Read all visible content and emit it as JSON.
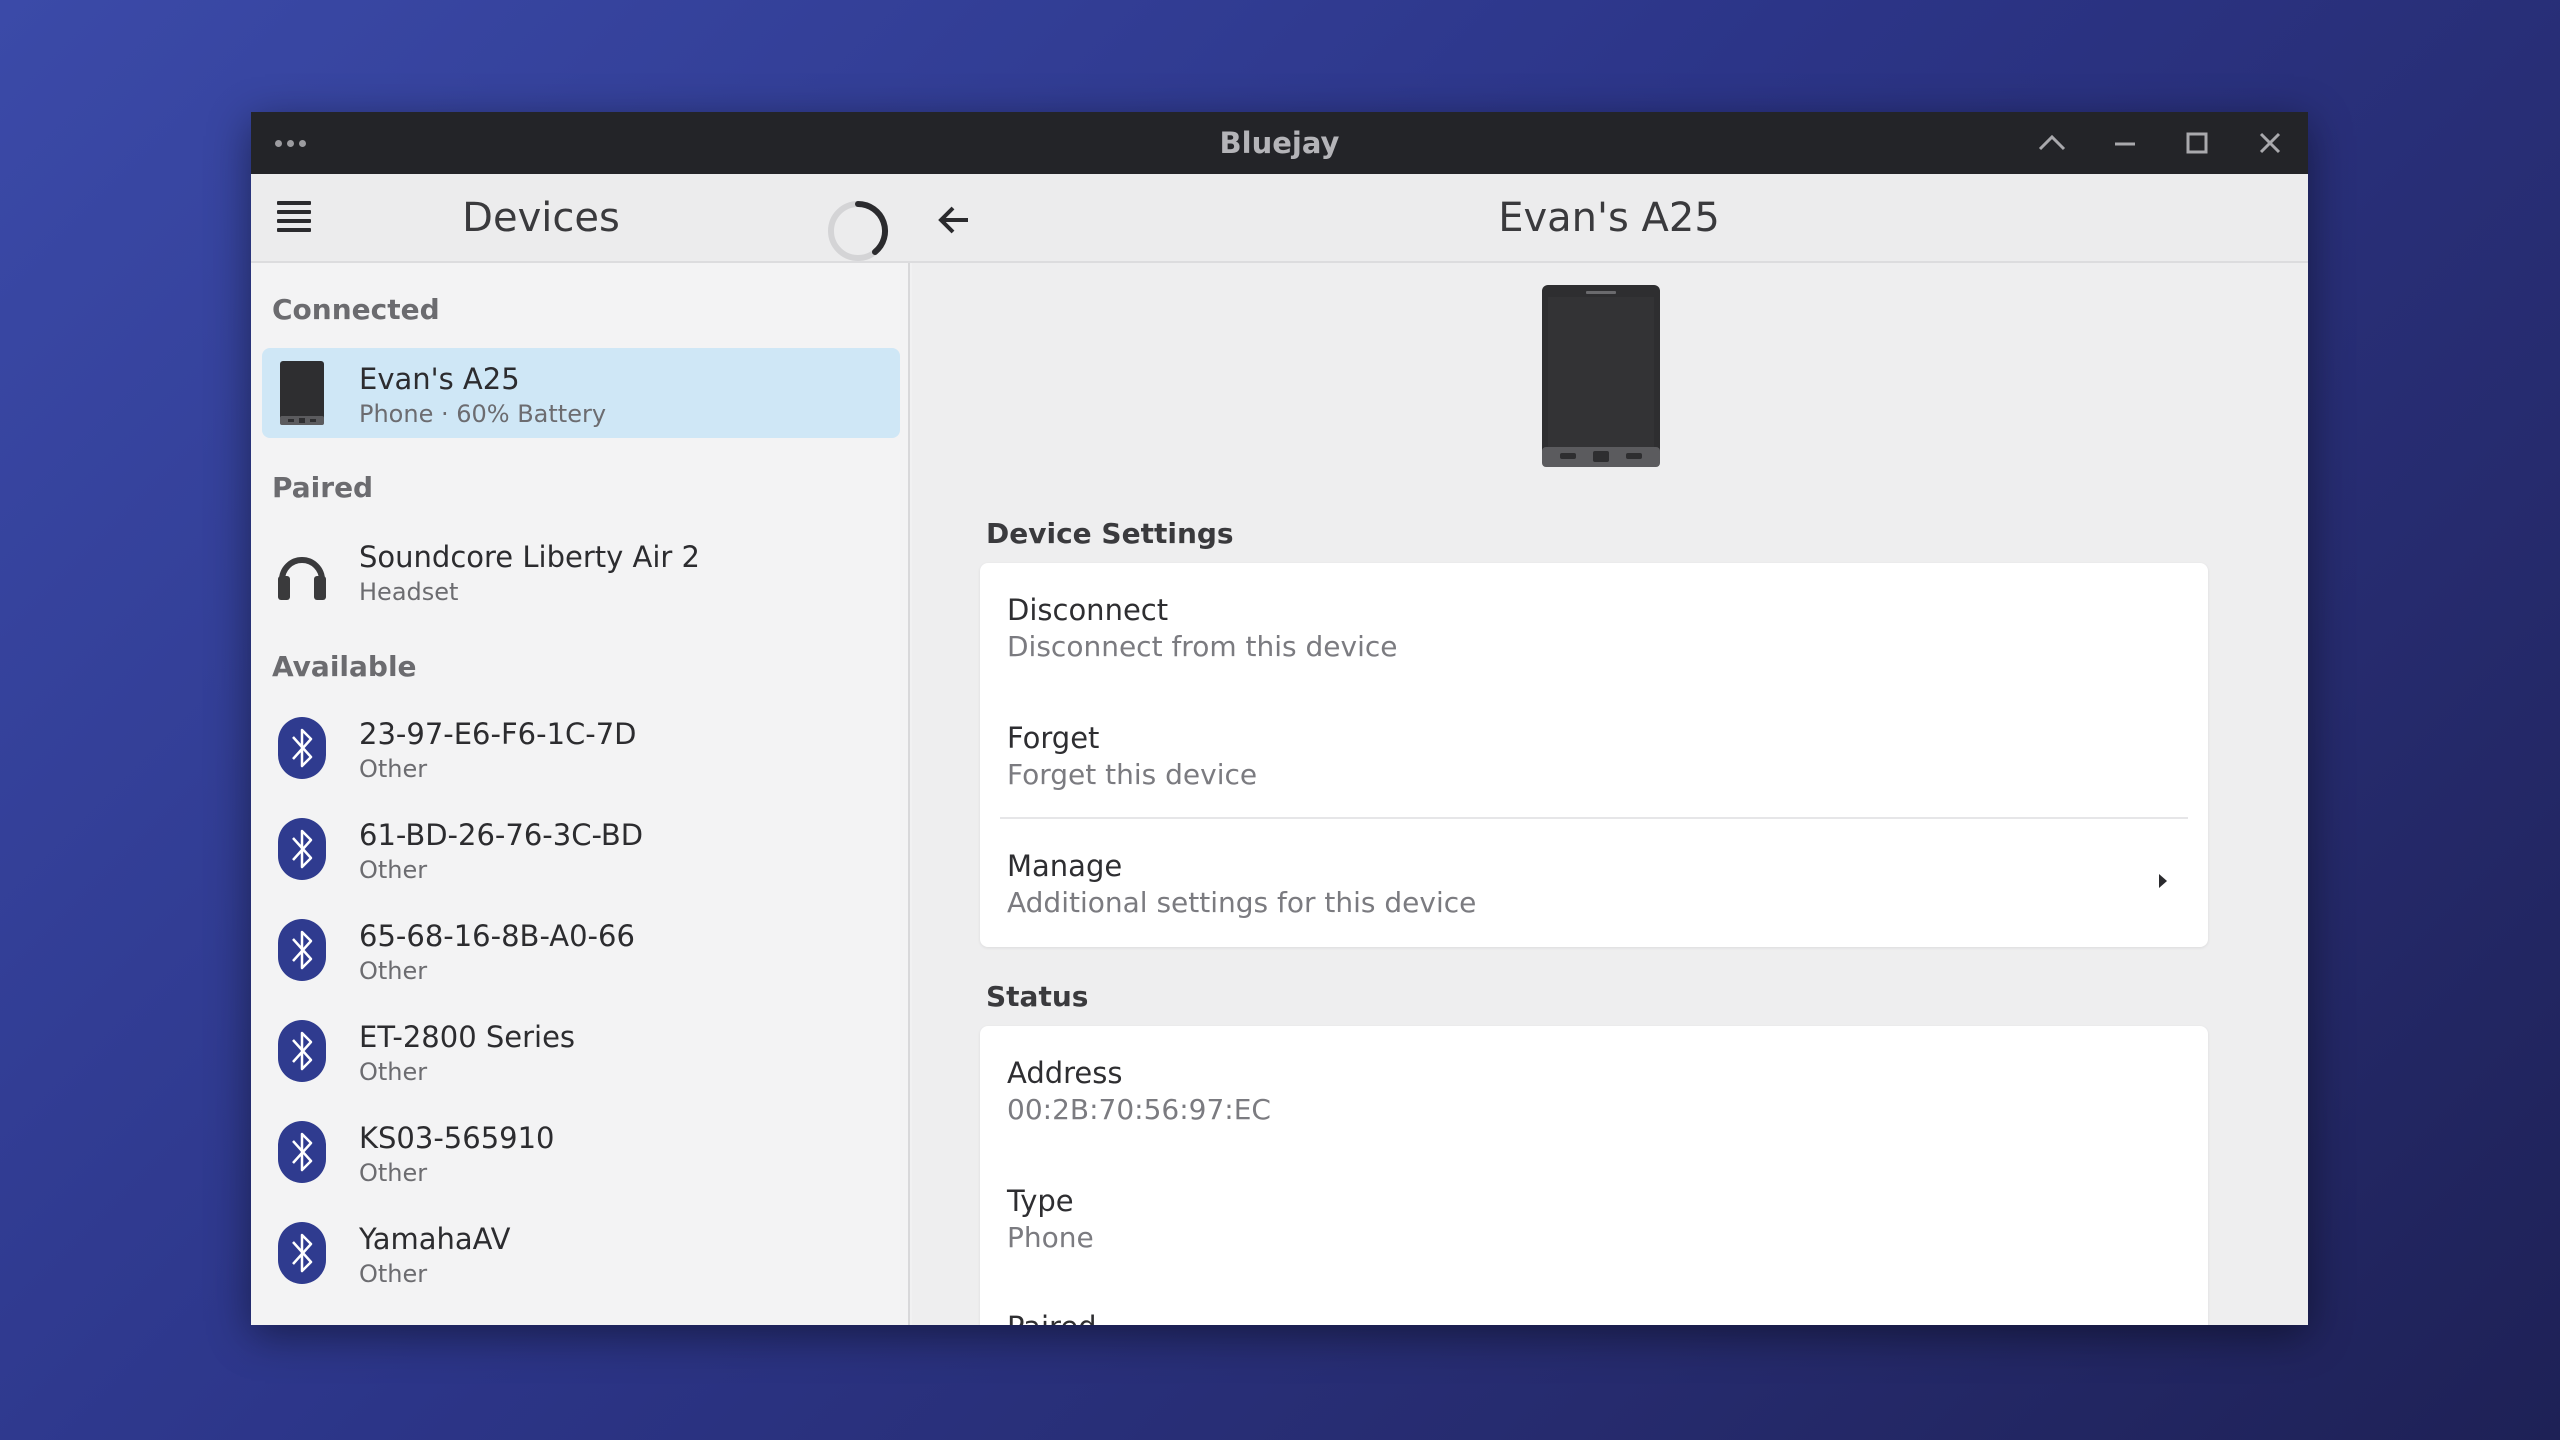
{
  "window": {
    "title": "Bluejay"
  },
  "left_header": {
    "title": "Devices"
  },
  "right_header": {
    "title": "Evan's A25"
  },
  "sections": {
    "connected": "Connected",
    "paired": "Paired",
    "available": "Available"
  },
  "connected_devices": [
    {
      "name": "Evan's A25",
      "sub": "Phone · 60% Battery",
      "icon": "phone-icon"
    }
  ],
  "paired_devices": [
    {
      "name": "Soundcore Liberty Air 2",
      "sub": "Headset",
      "icon": "headset-icon"
    }
  ],
  "available_devices": [
    {
      "name": "23-97-E6-F6-1C-7D",
      "sub": "Other",
      "icon": "bluetooth-icon"
    },
    {
      "name": "61-BD-26-76-3C-BD",
      "sub": "Other",
      "icon": "bluetooth-icon"
    },
    {
      "name": "65-68-16-8B-A0-66",
      "sub": "Other",
      "icon": "bluetooth-icon"
    },
    {
      "name": "ET-2800 Series",
      "sub": "Other",
      "icon": "bluetooth-icon"
    },
    {
      "name": "KS03-565910",
      "sub": "Other",
      "icon": "bluetooth-icon"
    },
    {
      "name": "YamahaAV",
      "sub": "Other",
      "icon": "bluetooth-icon"
    }
  ],
  "device_settings": {
    "label": "Device Settings",
    "disconnect": {
      "title": "Disconnect",
      "sub": "Disconnect from this device"
    },
    "forget": {
      "title": "Forget",
      "sub": "Forget this device"
    },
    "manage": {
      "title": "Manage",
      "sub": "Additional settings for this device"
    }
  },
  "status": {
    "label": "Status",
    "address": {
      "title": "Address",
      "value": "00:2B:70:56:97:EC"
    },
    "type": {
      "title": "Type",
      "value": "Phone"
    },
    "paired": {
      "title": "Paired"
    }
  },
  "colors": {
    "selected_row": "#cfe7f6",
    "bluetooth_badge": "#2f3b8f",
    "titlebar": "#232428"
  }
}
